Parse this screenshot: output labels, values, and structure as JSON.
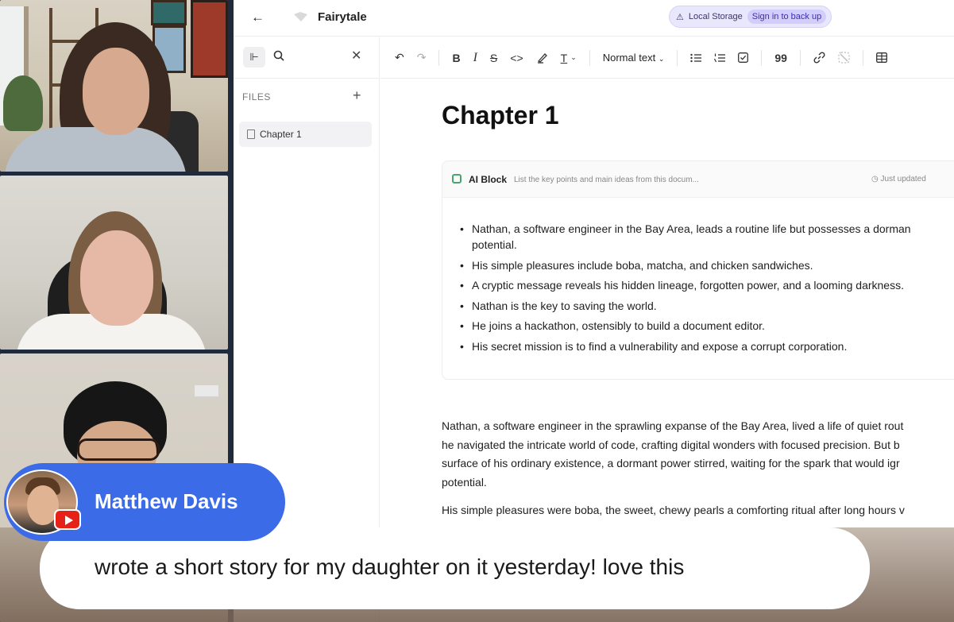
{
  "header": {
    "back_label": "←",
    "title": "Fairytale",
    "storage_label": "Local Storage",
    "signin_label": "Sign in to back up"
  },
  "sidebar": {
    "files_label": "FILES",
    "add_label": "+",
    "close_label": "✕",
    "files": [
      {
        "label": "Chapter 1"
      }
    ]
  },
  "toolbar": {
    "undo": "↶",
    "redo": "↷",
    "bold": "B",
    "italic": "I",
    "strike": "S",
    "code": "<>",
    "text_style": "T",
    "block_type": "Normal text",
    "quote": "99"
  },
  "document": {
    "heading": "Chapter 1",
    "ai_block": {
      "title": "AI Block",
      "prompt": "List the key points and main ideas from this docum...",
      "status": "Just updated",
      "points": [
        "Nathan, a software engineer in the Bay Area, leads a routine life but possesses a dorman",
        "potential.",
        "His simple pleasures include boba, matcha, and chicken sandwiches.",
        "A cryptic message reveals his hidden lineage, forgotten power, and a looming darkness.",
        "Nathan is the key to saving the world.",
        "He joins a hackathon, ostensibly to build a document editor.",
        "His secret mission is to find a vulnerability and expose a corrupt corporation."
      ]
    },
    "paragraph1": [
      "Nathan, a software engineer in the sprawling expanse of the Bay Area, lived a life of quiet rout",
      "he navigated the intricate world of code, crafting digital wonders with focused precision. But b",
      "surface of his ordinary existence, a dormant power stirred, waiting for the spark that would igr",
      "potential."
    ],
    "paragraph2": [
      "His simple pleasures were boba, the sweet, chewy pearls a comforting ritual after long hours v"
    ]
  },
  "overlay": {
    "speaker_name": "Matthew Davis",
    "comment": "wrote a short story for my daughter on it yesterday! love this"
  },
  "colors": {
    "accent": "#3c6be8",
    "storage_bg": "#e9e7fb",
    "ai_icon": "#47a66b"
  }
}
